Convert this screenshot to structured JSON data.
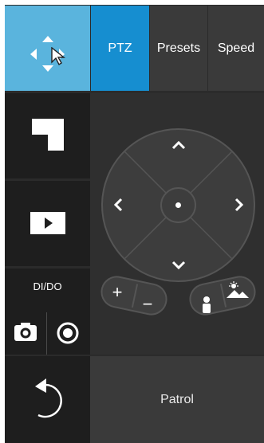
{
  "tabs": {
    "ptz": "PTZ",
    "presets": "Presets",
    "speed": "Speed"
  },
  "sidebar": {
    "dido_label": "DI/DO"
  },
  "zoom": {
    "in": "+",
    "out": "−"
  },
  "patrol": {
    "label": "Patrol"
  },
  "colors": {
    "accent": "#168ed0",
    "mode_active": "#5ab4dd",
    "panel": "#3a3a3a",
    "tile": "#1e1e1e"
  },
  "icons": [
    "move-arrows-icon",
    "cursor-icon",
    "layout-icon",
    "play-icon",
    "camera-icon",
    "record-icon",
    "undo-arrow-icon",
    "person-icon",
    "landscape-icon"
  ]
}
